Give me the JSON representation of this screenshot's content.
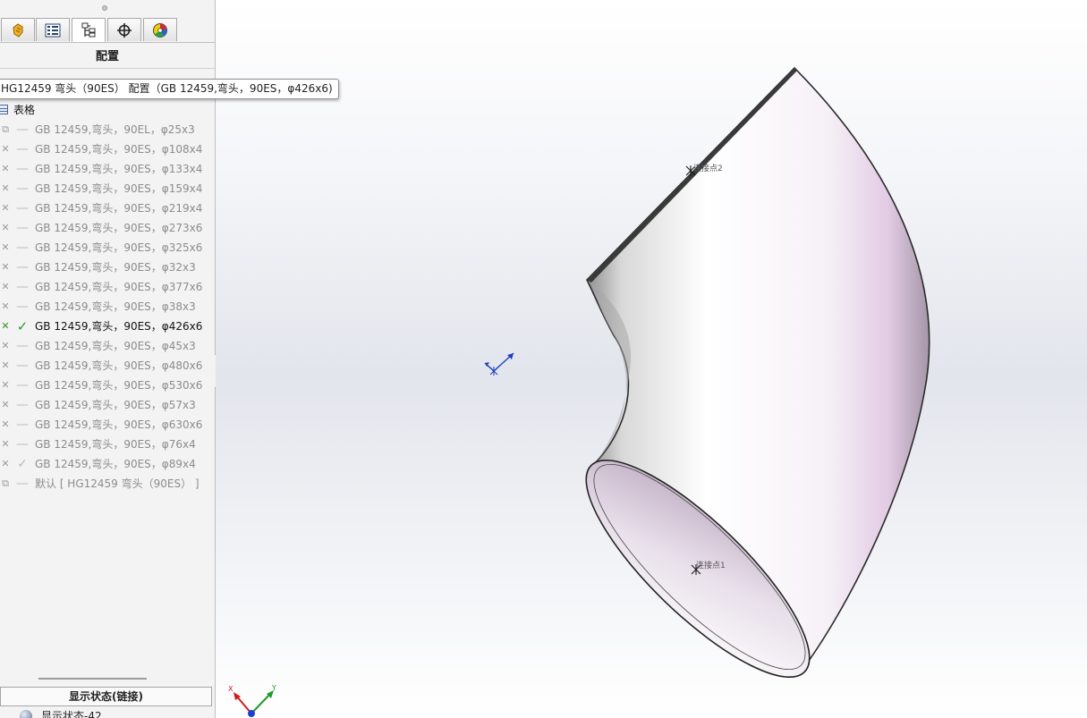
{
  "panel": {
    "title": "配置",
    "tabs": [
      {
        "name": "feature-manager",
        "icon": "hand-feature-icon"
      },
      {
        "name": "property-manager",
        "icon": "property-list-icon"
      },
      {
        "name": "configuration-manager",
        "icon": "configuration-icon",
        "active": true
      },
      {
        "name": "dimxpert-manager",
        "icon": "crosshair-icon"
      },
      {
        "name": "display-manager",
        "icon": "color-wheel-icon"
      }
    ],
    "tooltip": "HG12459 弯头（90ES） 配置（GB 12459,弯头，90ES，φ426x6)",
    "table_label": "表格",
    "configurations": [
      {
        "label": "GB 12459,弯头，90EL，φ25x3",
        "state": "default-type"
      },
      {
        "label": "GB 12459,弯头，90ES，φ108x4"
      },
      {
        "label": "GB 12459,弯头，90ES，φ133x4"
      },
      {
        "label": "GB 12459,弯头，90ES，φ159x4"
      },
      {
        "label": "GB 12459,弯头，90ES，φ219x4"
      },
      {
        "label": "GB 12459,弯头，90ES，φ273x6"
      },
      {
        "label": "GB 12459,弯头，90ES，φ325x6"
      },
      {
        "label": "GB 12459,弯头，90ES，φ32x3"
      },
      {
        "label": "GB 12459,弯头，90ES，φ377x6"
      },
      {
        "label": "GB 12459,弯头，90ES，φ38x3"
      },
      {
        "label": "GB 12459,弯头，90ES，φ426x6",
        "active": true
      },
      {
        "label": "GB 12459,弯头，90ES，φ45x3"
      },
      {
        "label": "GB 12459,弯头，90ES，φ480x6"
      },
      {
        "label": "GB 12459,弯头，90ES，φ530x6"
      },
      {
        "label": "GB 12459,弯头，90ES，φ57x3"
      },
      {
        "label": "GB 12459,弯头，90ES，φ630x6"
      },
      {
        "label": "GB 12459,弯头，90ES，φ76x4"
      },
      {
        "label": "GB 12459,弯头，90ES，φ89x4",
        "checked_gray": true
      },
      {
        "label": "默认 [ HG12459 弯头（90ES） ]",
        "state": "default-type"
      }
    ],
    "display_states_header": "显示状态(链接)",
    "display_state_item": "显示状态-42"
  },
  "viewport": {
    "connection_points": [
      "连接点2",
      "连接点1"
    ],
    "triad_axes": [
      "X",
      "Y"
    ],
    "colors": {
      "axis_x": "#d21b1b",
      "axis_y": "#1f9a2c",
      "axis_z": "#1b3fd2",
      "origin": "#1d3fbf"
    }
  }
}
